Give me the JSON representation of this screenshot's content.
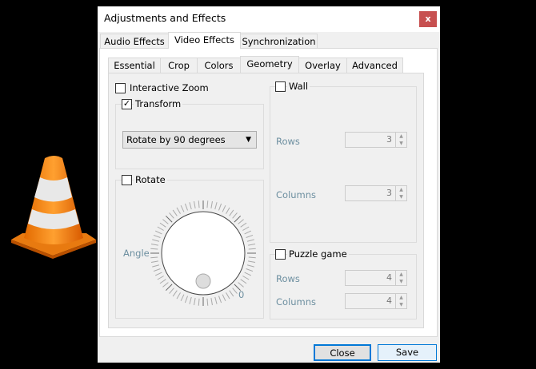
{
  "window": {
    "title": "Adjustments and Effects",
    "close_glyph": "x"
  },
  "tabs": [
    "Audio Effects",
    "Video Effects",
    "Synchronization"
  ],
  "active_tab": "Video Effects",
  "subtabs": [
    "Essential",
    "Crop",
    "Colors",
    "Geometry",
    "Overlay",
    "Advanced"
  ],
  "active_subtab": "Geometry",
  "geometry": {
    "interactive_zoom": {
      "label": "Interactive Zoom",
      "checked": false
    },
    "transform": {
      "label": "Transform",
      "checked": true,
      "selected": "Rotate by 90 degrees"
    },
    "rotate": {
      "label": "Rotate",
      "checked": false,
      "angle_label": "Angle",
      "angle_value": "0"
    },
    "wall": {
      "label": "Wall",
      "checked": false,
      "rows_label": "Rows",
      "rows": "3",
      "columns_label": "Columns",
      "columns": "3"
    },
    "puzzle": {
      "label": "Puzzle game",
      "checked": false,
      "rows_label": "Rows",
      "rows": "4",
      "columns_label": "Columns",
      "columns": "4"
    }
  },
  "buttons": {
    "close": "Close",
    "save": "Save"
  },
  "colors": {
    "close_button": "#c75050",
    "accent": "#0078d7",
    "cone_orange": "#f08a1c"
  }
}
